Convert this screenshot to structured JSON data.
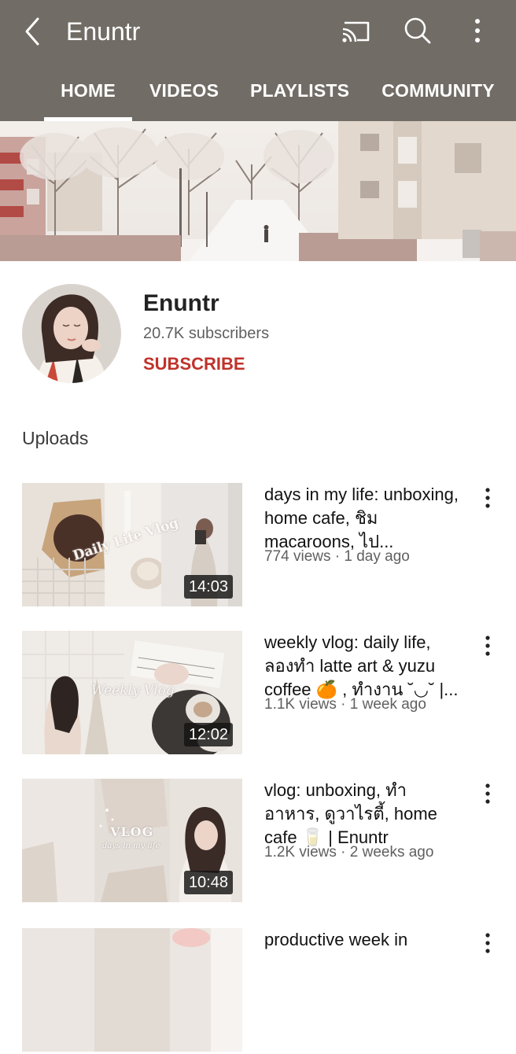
{
  "app_bar": {
    "title": "Enuntr",
    "icons": [
      "back-arrow-icon",
      "cast-icon",
      "search-icon",
      "more-vert-icon"
    ],
    "background": "#716c65"
  },
  "tabs": [
    {
      "label": "HOME",
      "selected": true
    },
    {
      "label": "VIDEOS",
      "selected": false
    },
    {
      "label": "PLAYLISTS",
      "selected": false
    },
    {
      "label": "COMMUNITY",
      "selected": false
    }
  ],
  "channel": {
    "name": "Enuntr",
    "subscribers": "20.7K subscribers",
    "subscribe_label": "SUBSCRIBE",
    "subscribe_color": "#c0322a"
  },
  "uploads": {
    "section_title": "Uploads",
    "videos": [
      {
        "title": "days in my life: unboxing, home cafe, ชิม macaroons, ไป...",
        "meta": "774 views · 1 day ago",
        "duration": "14:03",
        "thumb_caption": "Daily Life Vlog"
      },
      {
        "title": "weekly vlog: daily life, ลองทำ latte art & yuzu coffee 🍊 , ทำงาน ˘◡˘ |...",
        "meta": "1.1K views · 1 week ago",
        "duration": "12:02",
        "thumb_caption": "Weekly Vlog"
      },
      {
        "title": "vlog: unboxing, ทำอาหาร, ดูวาไรตี้, home cafe 🥛 | Enuntr",
        "meta": "1.2K views · 2 weeks ago",
        "duration": "10:48",
        "thumb_caption": "VLOG",
        "thumb_subcaption": "days in my life"
      },
      {
        "title": "productive week in",
        "meta": "",
        "duration": ""
      }
    ]
  }
}
